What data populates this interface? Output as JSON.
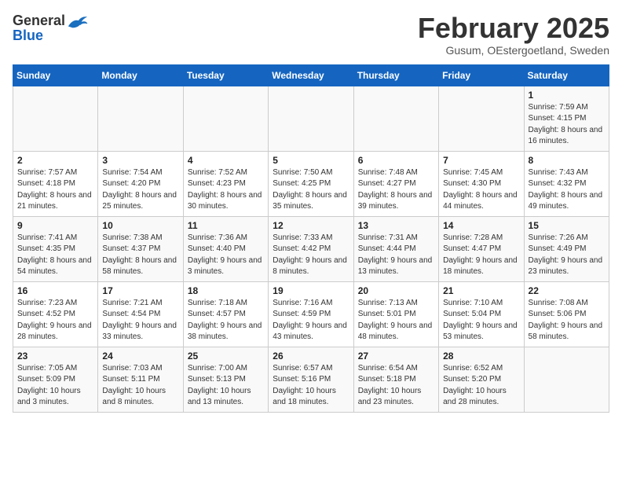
{
  "header": {
    "logo_general": "General",
    "logo_blue": "Blue",
    "month_title": "February 2025",
    "subtitle": "Gusum, OEstergoetland, Sweden"
  },
  "days_of_week": [
    "Sunday",
    "Monday",
    "Tuesday",
    "Wednesday",
    "Thursday",
    "Friday",
    "Saturday"
  ],
  "weeks": [
    [
      {
        "day": "",
        "info": ""
      },
      {
        "day": "",
        "info": ""
      },
      {
        "day": "",
        "info": ""
      },
      {
        "day": "",
        "info": ""
      },
      {
        "day": "",
        "info": ""
      },
      {
        "day": "",
        "info": ""
      },
      {
        "day": "1",
        "info": "Sunrise: 7:59 AM\nSunset: 4:15 PM\nDaylight: 8 hours and 16 minutes."
      }
    ],
    [
      {
        "day": "2",
        "info": "Sunrise: 7:57 AM\nSunset: 4:18 PM\nDaylight: 8 hours and 21 minutes."
      },
      {
        "day": "3",
        "info": "Sunrise: 7:54 AM\nSunset: 4:20 PM\nDaylight: 8 hours and 25 minutes."
      },
      {
        "day": "4",
        "info": "Sunrise: 7:52 AM\nSunset: 4:23 PM\nDaylight: 8 hours and 30 minutes."
      },
      {
        "day": "5",
        "info": "Sunrise: 7:50 AM\nSunset: 4:25 PM\nDaylight: 8 hours and 35 minutes."
      },
      {
        "day": "6",
        "info": "Sunrise: 7:48 AM\nSunset: 4:27 PM\nDaylight: 8 hours and 39 minutes."
      },
      {
        "day": "7",
        "info": "Sunrise: 7:45 AM\nSunset: 4:30 PM\nDaylight: 8 hours and 44 minutes."
      },
      {
        "day": "8",
        "info": "Sunrise: 7:43 AM\nSunset: 4:32 PM\nDaylight: 8 hours and 49 minutes."
      }
    ],
    [
      {
        "day": "9",
        "info": "Sunrise: 7:41 AM\nSunset: 4:35 PM\nDaylight: 8 hours and 54 minutes."
      },
      {
        "day": "10",
        "info": "Sunrise: 7:38 AM\nSunset: 4:37 PM\nDaylight: 8 hours and 58 minutes."
      },
      {
        "day": "11",
        "info": "Sunrise: 7:36 AM\nSunset: 4:40 PM\nDaylight: 9 hours and 3 minutes."
      },
      {
        "day": "12",
        "info": "Sunrise: 7:33 AM\nSunset: 4:42 PM\nDaylight: 9 hours and 8 minutes."
      },
      {
        "day": "13",
        "info": "Sunrise: 7:31 AM\nSunset: 4:44 PM\nDaylight: 9 hours and 13 minutes."
      },
      {
        "day": "14",
        "info": "Sunrise: 7:28 AM\nSunset: 4:47 PM\nDaylight: 9 hours and 18 minutes."
      },
      {
        "day": "15",
        "info": "Sunrise: 7:26 AM\nSunset: 4:49 PM\nDaylight: 9 hours and 23 minutes."
      }
    ],
    [
      {
        "day": "16",
        "info": "Sunrise: 7:23 AM\nSunset: 4:52 PM\nDaylight: 9 hours and 28 minutes."
      },
      {
        "day": "17",
        "info": "Sunrise: 7:21 AM\nSunset: 4:54 PM\nDaylight: 9 hours and 33 minutes."
      },
      {
        "day": "18",
        "info": "Sunrise: 7:18 AM\nSunset: 4:57 PM\nDaylight: 9 hours and 38 minutes."
      },
      {
        "day": "19",
        "info": "Sunrise: 7:16 AM\nSunset: 4:59 PM\nDaylight: 9 hours and 43 minutes."
      },
      {
        "day": "20",
        "info": "Sunrise: 7:13 AM\nSunset: 5:01 PM\nDaylight: 9 hours and 48 minutes."
      },
      {
        "day": "21",
        "info": "Sunrise: 7:10 AM\nSunset: 5:04 PM\nDaylight: 9 hours and 53 minutes."
      },
      {
        "day": "22",
        "info": "Sunrise: 7:08 AM\nSunset: 5:06 PM\nDaylight: 9 hours and 58 minutes."
      }
    ],
    [
      {
        "day": "23",
        "info": "Sunrise: 7:05 AM\nSunset: 5:09 PM\nDaylight: 10 hours and 3 minutes."
      },
      {
        "day": "24",
        "info": "Sunrise: 7:03 AM\nSunset: 5:11 PM\nDaylight: 10 hours and 8 minutes."
      },
      {
        "day": "25",
        "info": "Sunrise: 7:00 AM\nSunset: 5:13 PM\nDaylight: 10 hours and 13 minutes."
      },
      {
        "day": "26",
        "info": "Sunrise: 6:57 AM\nSunset: 5:16 PM\nDaylight: 10 hours and 18 minutes."
      },
      {
        "day": "27",
        "info": "Sunrise: 6:54 AM\nSunset: 5:18 PM\nDaylight: 10 hours and 23 minutes."
      },
      {
        "day": "28",
        "info": "Sunrise: 6:52 AM\nSunset: 5:20 PM\nDaylight: 10 hours and 28 minutes."
      },
      {
        "day": "",
        "info": ""
      }
    ]
  ]
}
